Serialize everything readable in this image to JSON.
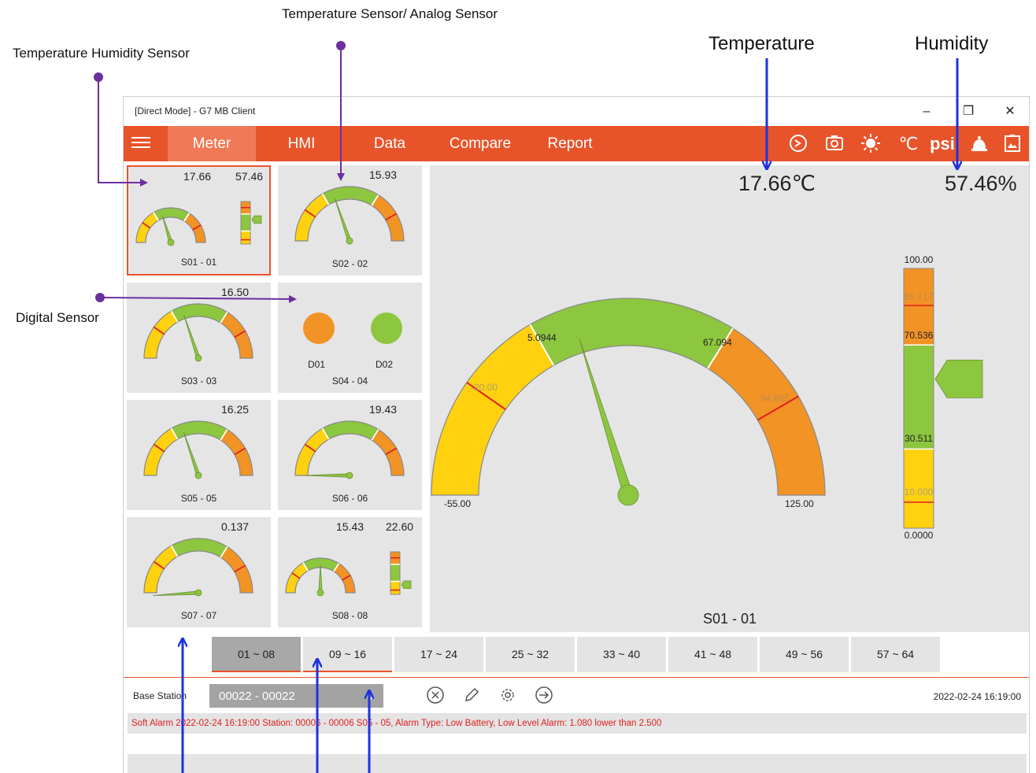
{
  "annotations": {
    "temp_hum_sensor": "Temperature Humidity Sensor",
    "temp_analog_sensor": "Temperature Sensor/ Analog Sensor",
    "digital_sensor": "Digital Sensor",
    "temperature": "Temperature",
    "humidity": "Humidity"
  },
  "window": {
    "title": "[Direct Mode] - G7 MB Client",
    "minimize": "–",
    "restore": "❐",
    "close": "✕"
  },
  "nav": {
    "tabs": [
      "Meter",
      "HMI",
      "Data",
      "Compare",
      "Report"
    ],
    "active_tab": "Meter",
    "icons": [
      "sync-icon",
      "camera-icon",
      "brightness-icon",
      "celsius-unit-icon",
      "psi-unit-icon",
      "alarm-bell-icon",
      "image-icon"
    ],
    "celsius_label": "℃",
    "psi_label": "psi"
  },
  "tiles": [
    {
      "label": "S01 - 01",
      "v1": "17.66",
      "v2": "57.46",
      "value": 17.66,
      "bar": 57.46,
      "selected": true
    },
    {
      "label": "S02 - 02",
      "v1": "15.93",
      "value": 15.93
    },
    {
      "label": "S03 - 03",
      "v1": "16.50",
      "value": 16.5
    },
    {
      "label": "S04 - 04",
      "digital": [
        "D01",
        "D02"
      ]
    },
    {
      "label": "S05 - 05",
      "v1": "16.25",
      "value": 16.25
    },
    {
      "label": "S06 - 06",
      "v1": "19.43",
      "value": -55
    },
    {
      "label": "S07 - 07",
      "v1": "0.137",
      "value": -60
    },
    {
      "label": "S08 - 08",
      "v1": "15.43",
      "v2": "22.60",
      "value": 35,
      "bar": 22.6
    }
  ],
  "colors": {
    "accent": "#e8542a",
    "gauge_yellow": "#ffd10f",
    "gauge_green": "#8dc63f",
    "gauge_orange": "#f29325",
    "alarm_red": "#e02020",
    "digital_on": "#f29325",
    "digital_ok": "#8dc63f"
  },
  "main": {
    "temperature_reading": "17.66℃",
    "humidity_reading": "57.46%",
    "label": "S01 - 01",
    "gauge": {
      "min_label": "-55.00",
      "max_label": "125.00",
      "warn_low_label": "-20.00",
      "ok_low_label": "5.0944",
      "ok_high_label": "67.094",
      "warn_high_label": "94.865",
      "min": -55,
      "max": 125,
      "value": 17.66
    },
    "bar": {
      "max_label": "100.00",
      "min_label": "0.0000",
      "high_alarm_label": "85.717",
      "high_label": "70.536",
      "low_label": "30.511",
      "low_alarm_label": "10.000",
      "value": 57.46
    }
  },
  "pages": [
    "01 ~ 08",
    "09 ~ 16",
    "17 ~ 24",
    "25 ~ 32",
    "33 ~ 40",
    "41 ~ 48",
    "49 ~ 56",
    "57 ~ 64"
  ],
  "active_page": "01 ~ 08",
  "base_station": {
    "label": "Base Station",
    "value": "00022 - 00022",
    "caret": "⌄",
    "tools": [
      "cancel-icon",
      "edit-icon",
      "settings-icon",
      "export-icon"
    ],
    "timestamp": "2022-02-24 16:19:00"
  },
  "alarms": [
    "Soft Alarm   2022-02-24 16:19:00   Station: 00006 - 00006   S05 - 05, Alarm Type: Low Battery, Low Level Alarm: 1.080 lower than 2.500"
  ]
}
